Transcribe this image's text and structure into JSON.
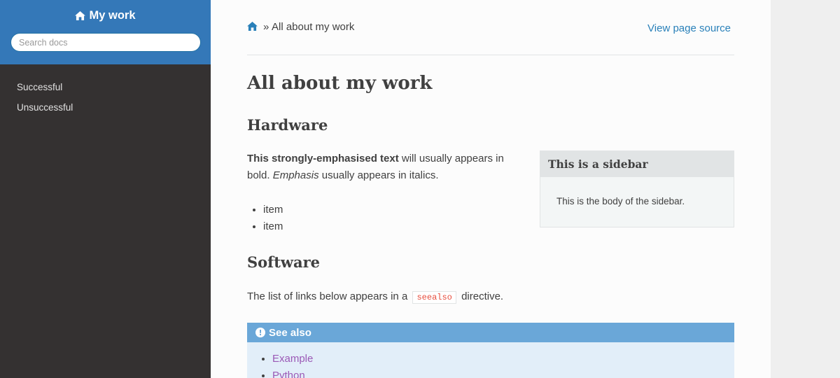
{
  "sidebar": {
    "project_title": "My work",
    "search_placeholder": "Search docs",
    "nav": [
      {
        "label": "Successful"
      },
      {
        "label": "Unsuccessful"
      }
    ]
  },
  "breadcrumbs": {
    "separator": "»",
    "current": "All about my work",
    "source_link": "View page source"
  },
  "page": {
    "title": "All about my work",
    "hardware": {
      "heading": "Hardware",
      "strong_text": "This strongly-emphasised text",
      "text_after_strong": " will usually appears in bold. ",
      "emphasis_text": "Emphasis",
      "text_after_emphasis": " usually appears in italics.",
      "bullets": [
        "item",
        "item"
      ]
    },
    "sidebar_box": {
      "title": "This is a sidebar",
      "body": "This is the body of the sidebar."
    },
    "software": {
      "heading": "Software",
      "text_before_code": "The list of links below appears in a",
      "code": "seealso",
      "text_after_code": "directive."
    },
    "seealso": {
      "title": "See also",
      "links": [
        "Example",
        "Python"
      ]
    }
  },
  "colors": {
    "brand_blue": "#3478b8",
    "link_blue": "#2980b9",
    "visited_purple": "#9b59b6",
    "sidebar_dark": "#343131"
  }
}
